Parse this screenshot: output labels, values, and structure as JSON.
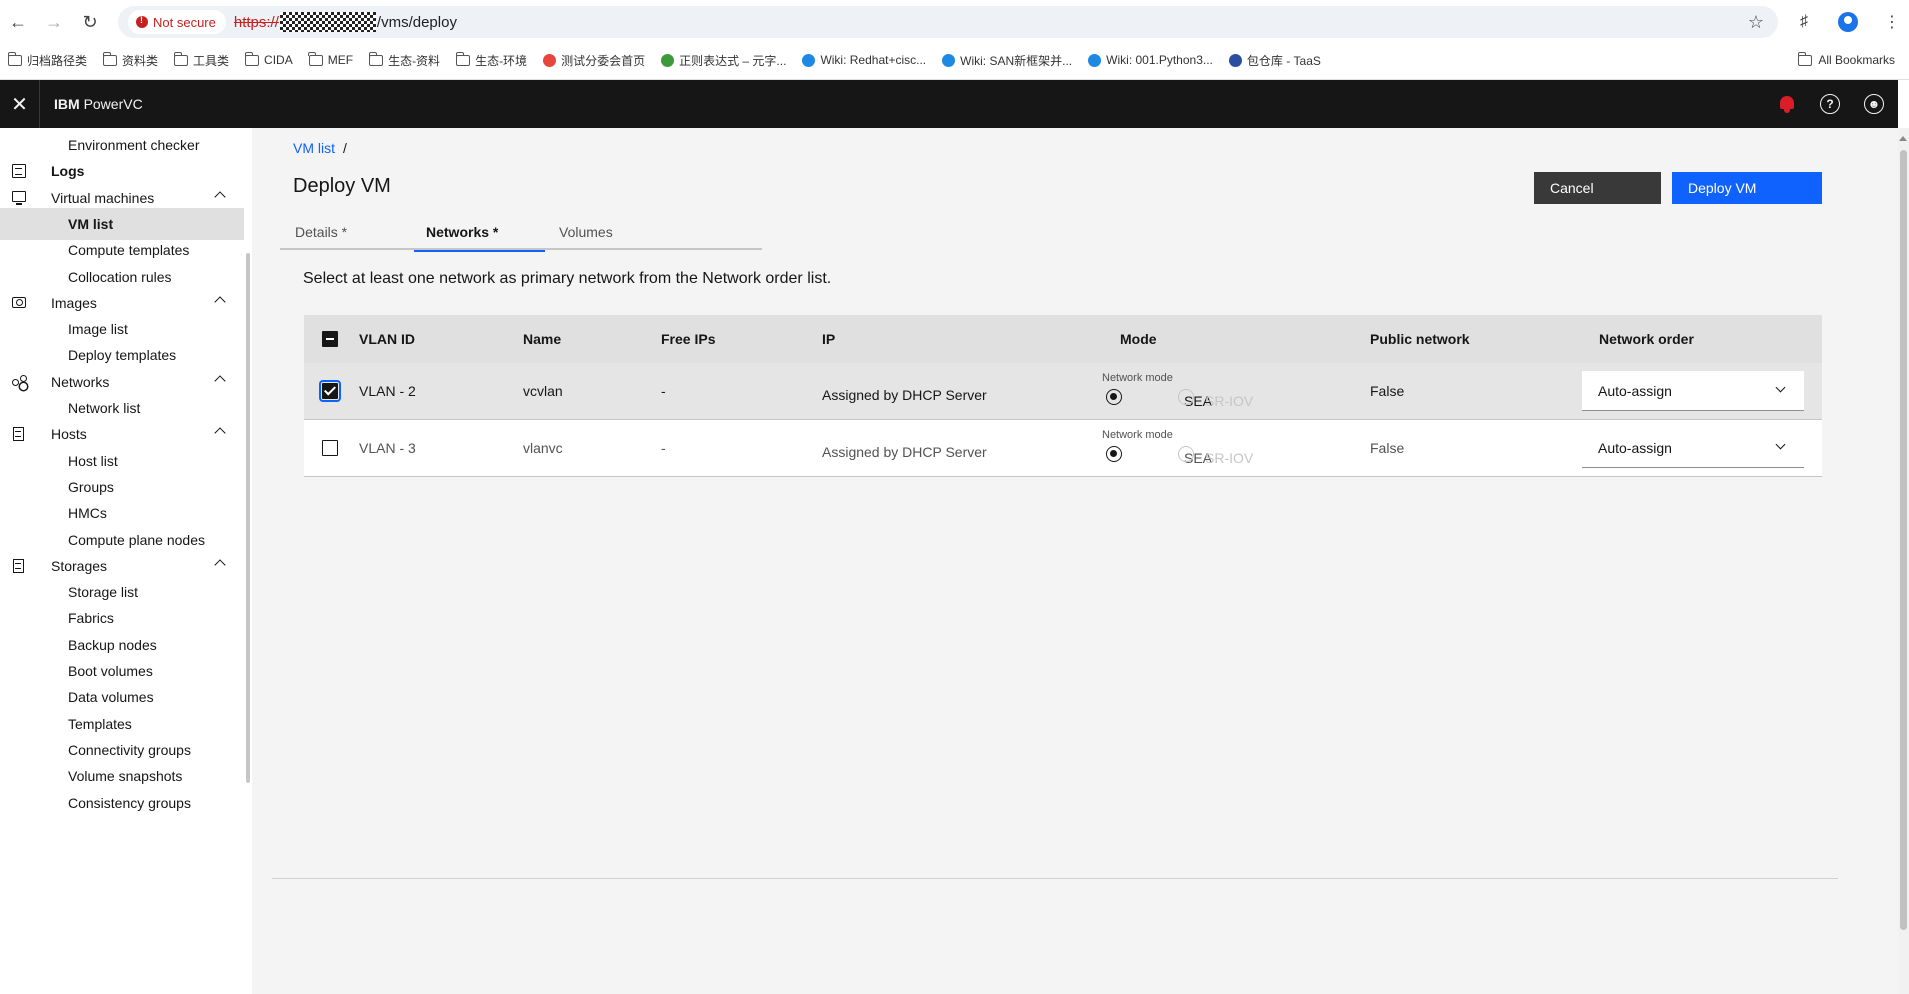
{
  "browser": {
    "security_label": "Not secure",
    "url_scheme": "https://",
    "url_path": "/vms/deploy",
    "bookmarks": [
      {
        "label": "归档路径类",
        "type": "folder"
      },
      {
        "label": "资料类",
        "type": "folder"
      },
      {
        "label": "工具类",
        "type": "folder"
      },
      {
        "label": "CIDA",
        "type": "folder"
      },
      {
        "label": "MEF",
        "type": "folder"
      },
      {
        "label": "生态-资料",
        "type": "folder"
      },
      {
        "label": "生态-环境",
        "type": "folder"
      },
      {
        "label": "测试分委会首页",
        "type": "site",
        "color": "#e8453c"
      },
      {
        "label": "正则表达式 – 元字...",
        "type": "site",
        "color": "#3c9a3c"
      },
      {
        "label": "Wiki: Redhat+cisc...",
        "type": "site",
        "color": "#1e88e5"
      },
      {
        "label": "Wiki: SAN新框架并...",
        "type": "site",
        "color": "#1e88e5"
      },
      {
        "label": "Wiki: 001.Python3...",
        "type": "site",
        "color": "#1e88e5"
      },
      {
        "label": "包仓库 - TaaS",
        "type": "site",
        "color": "#2b4fa0"
      }
    ],
    "all_bookmarks": "All Bookmarks"
  },
  "header": {
    "brand_ibm": "IBM",
    "brand_product": "PowerVC"
  },
  "sidebar": {
    "items": [
      {
        "label": "Environment checker",
        "level": "sub"
      },
      {
        "label": "Logs",
        "level": "top",
        "icon": "logs-icon"
      },
      {
        "label": "Virtual machines",
        "level": "cat",
        "icon": "monitor-icon"
      },
      {
        "label": "VM list",
        "level": "sub",
        "active": true
      },
      {
        "label": "Compute templates",
        "level": "sub"
      },
      {
        "label": "Collocation rules",
        "level": "sub"
      },
      {
        "label": "Images",
        "level": "cat",
        "icon": "camera-icon"
      },
      {
        "label": "Image list",
        "level": "sub"
      },
      {
        "label": "Deploy templates",
        "level": "sub"
      },
      {
        "label": "Networks",
        "level": "cat",
        "icon": "network-icon"
      },
      {
        "label": "Network list",
        "level": "sub"
      },
      {
        "label": "Hosts",
        "level": "cat",
        "icon": "server-icon"
      },
      {
        "label": "Host list",
        "level": "sub"
      },
      {
        "label": "Groups",
        "level": "sub"
      },
      {
        "label": "HMCs",
        "level": "sub"
      },
      {
        "label": "Compute plane nodes",
        "level": "sub"
      },
      {
        "label": "Storages",
        "level": "cat",
        "icon": "storage-icon"
      },
      {
        "label": "Storage list",
        "level": "sub"
      },
      {
        "label": "Fabrics",
        "level": "sub"
      },
      {
        "label": "Backup nodes",
        "level": "sub"
      },
      {
        "label": "Boot volumes",
        "level": "sub"
      },
      {
        "label": "Data volumes",
        "level": "sub"
      },
      {
        "label": "Templates",
        "level": "sub"
      },
      {
        "label": "Connectivity groups",
        "level": "sub"
      },
      {
        "label": "Volume snapshots",
        "level": "sub"
      },
      {
        "label": "Consistency groups",
        "level": "sub"
      }
    ]
  },
  "main": {
    "breadcrumb_link": "VM list",
    "breadcrumb_sep": "/",
    "title": "Deploy VM",
    "cancel_label": "Cancel",
    "deploy_label": "Deploy VM",
    "tabs": [
      {
        "label": "Details *"
      },
      {
        "label": "Networks *",
        "active": true
      },
      {
        "label": "Volumes"
      }
    ],
    "instruction": "Select at least one network as primary network from the Network order list.",
    "table": {
      "columns": [
        "VLAN ID",
        "Name",
        "Free IPs",
        "IP",
        "Mode",
        "Public network",
        "Network order"
      ],
      "rows": [
        {
          "vlan": "VLAN - 2",
          "name": "vcvlan",
          "free_ips": "-",
          "ip": "Assigned by DHCP Server",
          "mode_label": "Network mode",
          "mode_opt1": "SEA",
          "mode_opt2": "SR-IOV",
          "public": "False",
          "order": "Auto-assign",
          "checked": true
        },
        {
          "vlan": "VLAN - 3",
          "name": "vlanvc",
          "free_ips": "-",
          "ip": "Assigned by DHCP Server",
          "mode_label": "Network mode",
          "mode_opt1": "SEA",
          "mode_opt2": "SR-IOV",
          "public": "False",
          "order": "Auto-assign",
          "checked": false
        }
      ]
    }
  },
  "colors": {
    "header_bg": "#161616",
    "primary": "#0f62fe",
    "alert": "#da1e28",
    "page_bg": "#f4f4f4"
  }
}
